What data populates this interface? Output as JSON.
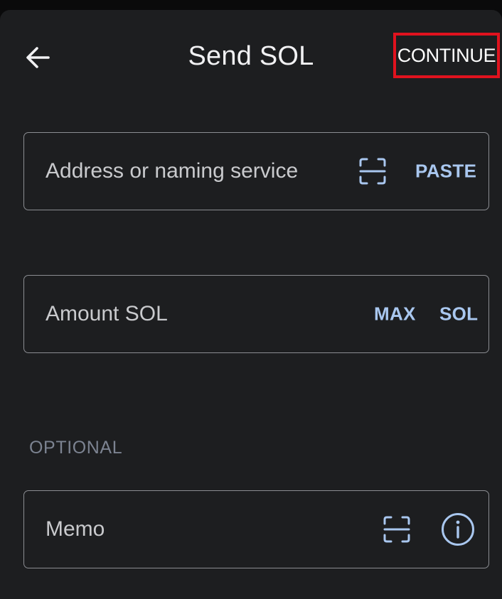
{
  "header": {
    "title": "Send SOL",
    "continue_label": "CONTINUE",
    "back_icon": "arrow-left-icon"
  },
  "address_field": {
    "placeholder": "Address or naming service",
    "scan_icon": "scan-icon",
    "paste_label": "PASTE"
  },
  "amount_field": {
    "placeholder": "Amount SOL",
    "max_label": "MAX",
    "unit_label": "SOL"
  },
  "optional_section": {
    "label": "OPTIONAL"
  },
  "memo_field": {
    "placeholder": "Memo",
    "scan_icon": "scan-icon",
    "info_icon": "info-icon"
  },
  "colors": {
    "background": "#1d1e20",
    "accent": "#a9c7ef",
    "highlight_border": "#e0121e",
    "field_border": "#8b8d92",
    "muted_label": "#7c8391"
  }
}
